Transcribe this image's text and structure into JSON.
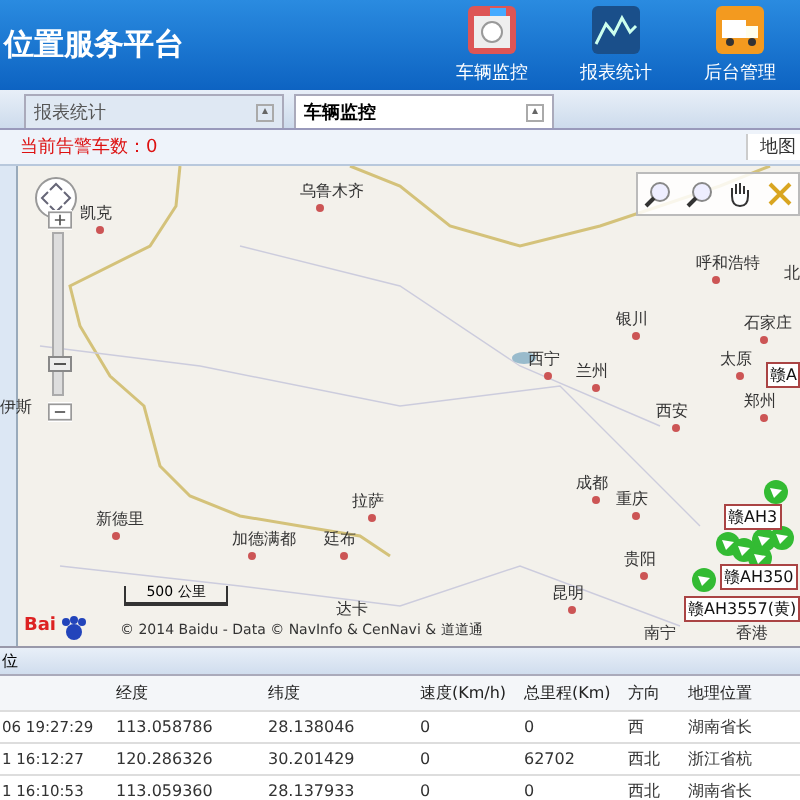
{
  "header": {
    "title": "位置服务平台",
    "nav": [
      {
        "label": "车辆监控",
        "kind": "monitor"
      },
      {
        "label": "报表统计",
        "kind": "chart"
      },
      {
        "label": "后台管理",
        "kind": "truck"
      }
    ]
  },
  "tabs": [
    {
      "label": "报表统计",
      "selected": false
    },
    {
      "label": "车辆监控",
      "selected": true
    }
  ],
  "toolbar": {
    "alarm_label": "当前告警车数：",
    "alarm_count": "0",
    "map_button": "地图"
  },
  "map": {
    "cities": [
      "乌鲁木齐",
      "凯克",
      "伊斯",
      "新德里",
      "加德满都",
      "廷布",
      "拉萨",
      "达卡",
      "呼和浩特",
      "银川",
      "石家庄",
      "太原",
      "西宁",
      "兰州",
      "西安",
      "郑州",
      "成都",
      "重庆",
      "贵阳",
      "昆明",
      "南宁",
      "香港",
      "北"
    ],
    "vehicles": [
      {
        "plate": "赣A"
      },
      {
        "plate": "赣AH3"
      },
      {
        "plate": "赣AH350"
      },
      {
        "plate": "赣AH3557(黄)"
      }
    ],
    "zoom": {
      "level": 0.2
    },
    "scale": "500 公里",
    "logo": "Bai",
    "copyright": "© 2014 Baidu - Data © NavInfo & CenNavi & 道道通"
  },
  "bottom_tab": "位",
  "table": {
    "columns": [
      "",
      "经度",
      "纬度",
      "速度(Km/h)",
      "总里程(Km)",
      "方向",
      "地理位置"
    ],
    "rows": [
      [
        "06 19:27:29",
        "113.058786",
        "28.138046",
        "0",
        "0",
        "西",
        "湖南省长"
      ],
      [
        "1 16:12:27",
        "120.286326",
        "30.201429",
        "0",
        "62702",
        "西北",
        "浙江省杭"
      ],
      [
        "1 16:10:53",
        "113.059360",
        "28.137933",
        "0",
        "0",
        "西北",
        "湖南省长"
      ]
    ]
  }
}
